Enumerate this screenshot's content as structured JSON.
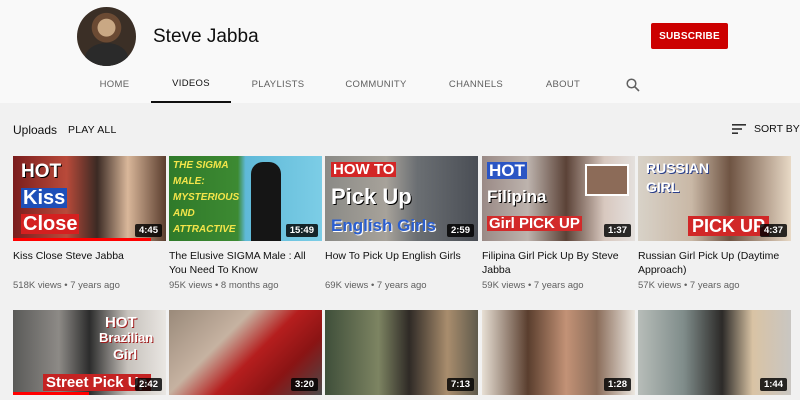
{
  "channel": {
    "name": "Steve Jabba",
    "subscribe_label": "SUBSCRIBE"
  },
  "tabs": [
    {
      "label": "HOME"
    },
    {
      "label": "VIDEOS",
      "active": true
    },
    {
      "label": "PLAYLISTS"
    },
    {
      "label": "COMMUNITY"
    },
    {
      "label": "CHANNELS"
    },
    {
      "label": "ABOUT"
    }
  ],
  "uploads": {
    "label": "Uploads",
    "play_all": "PLAY ALL",
    "sort_by": "SORT BY"
  },
  "colors": {
    "subscribe": "#cc0000",
    "progress": "#ff0000"
  },
  "videos": [
    {
      "title": "Kiss Close Steve Jabba",
      "views": "518K views",
      "age": "7 years ago",
      "duration": "4:45",
      "thumb_text": [
        "HOT",
        "Kiss",
        "Close"
      ],
      "watched": 0.9
    },
    {
      "title": "The Elusive SIGMA Male : All You Need To Know",
      "views": "95K views",
      "age": "8 months ago",
      "duration": "15:49",
      "thumb_text": [
        "THE SIGMA",
        "MALE:",
        "MYSTERIOUS",
        "AND",
        "ATTRACTIVE"
      ],
      "watched": 0
    },
    {
      "title": "How To Pick Up English Girls",
      "views": "69K views",
      "age": "7 years ago",
      "duration": "2:59",
      "thumb_text": [
        "HOW TO",
        "Pick Up",
        "English Girls"
      ],
      "watched": 0
    },
    {
      "title": "Filipina Girl Pick Up By Steve Jabba",
      "views": "59K views",
      "age": "7 years ago",
      "duration": "1:37",
      "thumb_text": [
        "HOT",
        "Filipina",
        "Girl PICK UP"
      ],
      "watched": 0
    },
    {
      "title": "Russian Girl Pick Up (Daytime Approach)",
      "views": "57K views",
      "age": "7 years ago",
      "duration": "4:37",
      "thumb_text": [
        "RUSSIAN",
        "GIRL",
        "PICK UP"
      ],
      "watched": 0
    },
    {
      "title": "",
      "views": "",
      "age": "",
      "duration": "2:42",
      "thumb_text": [
        "HOT",
        "Brazilian",
        "Girl",
        "Street Pick Up"
      ],
      "watched": 0.5
    },
    {
      "title": "",
      "views": "",
      "age": "",
      "duration": "3:20",
      "thumb_text": [],
      "watched": 0
    },
    {
      "title": "",
      "views": "",
      "age": "",
      "duration": "7:13",
      "thumb_text": [],
      "watched": 0
    },
    {
      "title": "",
      "views": "",
      "age": "",
      "duration": "1:28",
      "thumb_text": [],
      "watched": 0
    },
    {
      "title": "",
      "views": "",
      "age": "",
      "duration": "1:44",
      "thumb_text": [],
      "watched": 0
    }
  ]
}
